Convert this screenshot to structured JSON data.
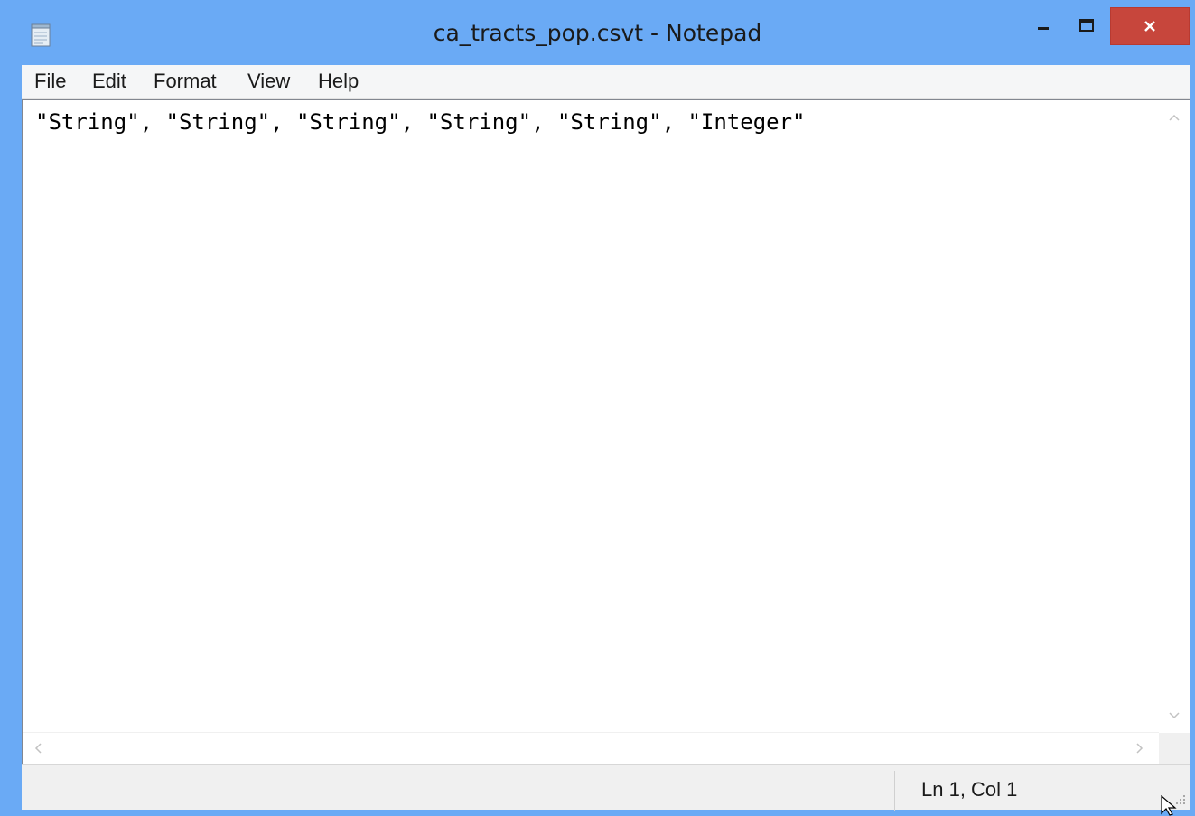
{
  "window": {
    "title": "ca_tracts_pop.csvt - Notepad",
    "app_icon": "notepad-icon",
    "controls": {
      "minimize_icon": "minimize-icon",
      "maximize_icon": "maximize-icon",
      "close_label": "✕"
    }
  },
  "menu": {
    "items": [
      {
        "label": "File"
      },
      {
        "label": "Edit"
      },
      {
        "label": "Format"
      },
      {
        "label": "View"
      },
      {
        "label": "Help"
      }
    ]
  },
  "editor": {
    "content": "\"String\", \"String\", \"String\", \"String\", \"String\", \"Integer\""
  },
  "scrollbars": {
    "up_arrow": "^",
    "down_arrow": "v",
    "left_arrow": "<",
    "right_arrow": ">"
  },
  "status": {
    "position": "Ln 1, Col 1"
  },
  "colors": {
    "frame": "#6aaaf5",
    "close_button": "#c7463c",
    "menu_background": "#f5f6f7",
    "status_background": "#f0f0f0"
  }
}
